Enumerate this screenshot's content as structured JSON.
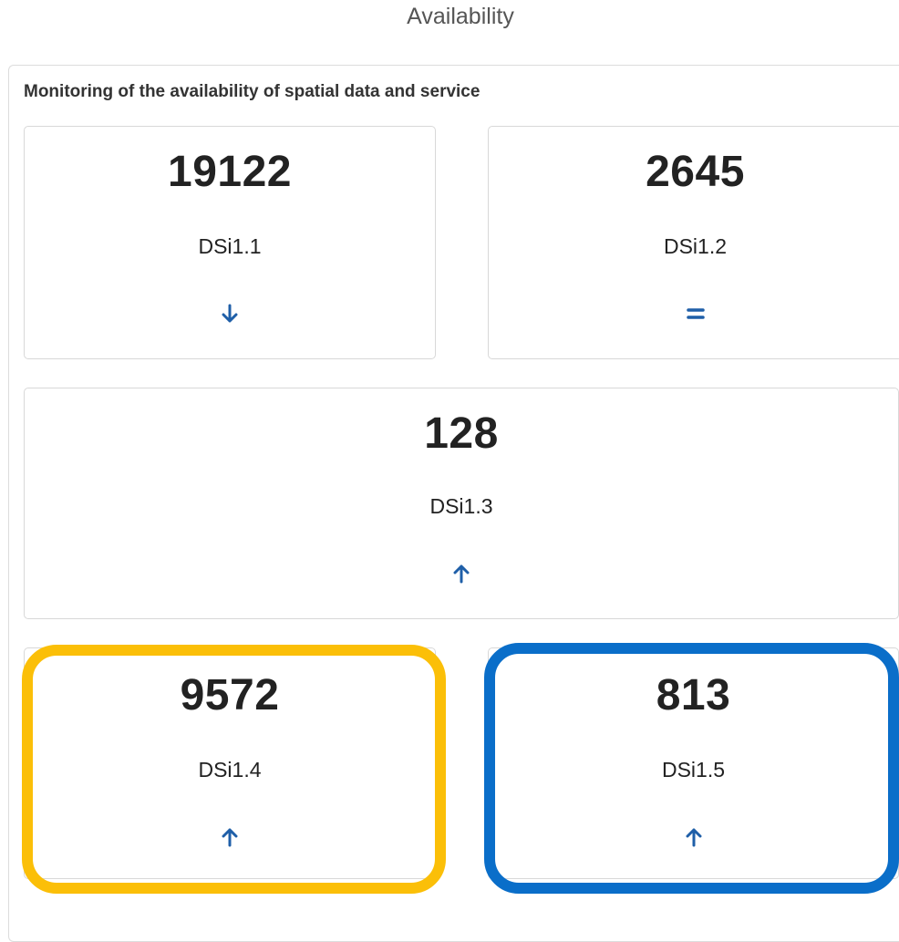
{
  "title": "Availability",
  "panel": {
    "heading": "Monitoring of the availability of spatial data and service"
  },
  "indicators": [
    {
      "value": "19122",
      "code": "DSi1.1",
      "trend": "down",
      "trend_icon": "arrow-down-icon"
    },
    {
      "value": "2645",
      "code": "DSi1.2",
      "trend": "equal",
      "trend_icon": "equals-icon"
    },
    {
      "value": "128",
      "code": "DSi1.3",
      "trend": "up",
      "trend_icon": "arrow-up-icon"
    },
    {
      "value": "9572",
      "code": "DSi1.4",
      "trend": "up",
      "trend_icon": "arrow-up-icon"
    },
    {
      "value": "813",
      "code": "DSi1.5",
      "trend": "up",
      "trend_icon": "arrow-up-icon"
    }
  ],
  "colors": {
    "trend": "#1f5fa8",
    "highlight_yellow": "#fbbf08",
    "highlight_blue": "#0a6ec9"
  }
}
